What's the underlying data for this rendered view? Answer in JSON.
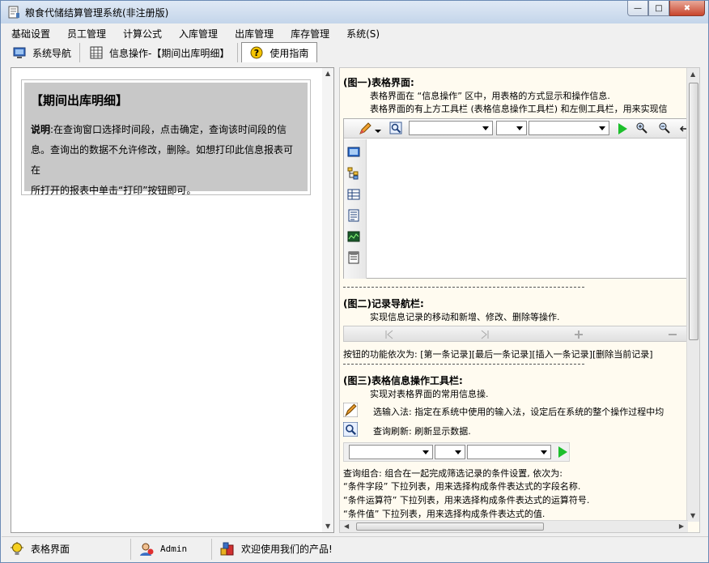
{
  "window": {
    "title": "粮食代储结算管理系统(非注册版)",
    "minimize_glyph": "—",
    "maximize_glyph": "□",
    "close_glyph": "✖"
  },
  "menu": {
    "items": [
      "基础设置",
      "员工管理",
      "计算公式",
      "入库管理",
      "出库管理",
      "库存管理",
      "系统(S)"
    ]
  },
  "tabs": [
    {
      "label": "系统导航",
      "icon": "monitor-icon"
    },
    {
      "label": "信息操作-【期间出库明细】",
      "icon": "grid-icon"
    },
    {
      "label": "使用指南",
      "icon": "help-icon"
    }
  ],
  "left": {
    "title": "【期间出库明细】",
    "desc_label": "说明",
    "desc_lines": [
      ":在查询窗口选择时间段，点击确定，查询该时间段的信",
      "息。查询出的数据不允许修改，删除。如想打印此信息报表可在",
      "所打开的报表中单击“打印”按钮即可。"
    ]
  },
  "guide": {
    "fig1_title": "(图一)表格界面:",
    "fig1_l1": "表格界面在 “信息操作” 区中，用表格的方式显示和操作信息.",
    "fig1_l2": "表格界面的有上方工具栏 (表格信息操作工具栏) 和左侧工具栏，用来实现信",
    "sep1": "------------------------------------------------------------",
    "fig2_title": "(图二)记录导航栏:",
    "fig2_l1": "实现信息记录的移动和新增、修改、删除等操作.",
    "fig2_l2": "按钮的功能依次为: [第一条记录][最后一条记录][插入一条记录][删除当前记录]",
    "sep2": "------------------------------------------------------------",
    "fig3_title": "(图三)表格信息操作工具栏:",
    "fig3_l1": "实现对表格界面的常用信息操.",
    "fig3_input": "选输入法: 指定在系统中使用的输入法，设定后在系统的整个操作过程中均",
    "fig3_refresh": "查询刷新: 刷新显示数据.",
    "combo_l1": "查询组合: 组合在一起完成筛选记录的条件设置, 依次为:",
    "combo_l2": "“条件字段” 下拉列表，用来选择构成条件表达式的字段名称.",
    "combo_l3": "“条件运算符” 下拉列表，用来选择构成条件表达式的运算符号.",
    "combo_l4": "“条件值” 下拉列表，用来选择构成条件表达式的值."
  },
  "status": {
    "cell1": "表格界面",
    "cell2": "Admin",
    "cell3": "欢迎使用我们的产品!"
  },
  "colors": {
    "guide_bg": "#fffbf0",
    "panel_gray": "#c8c8c8",
    "titlebar": "#c4d5ea"
  }
}
